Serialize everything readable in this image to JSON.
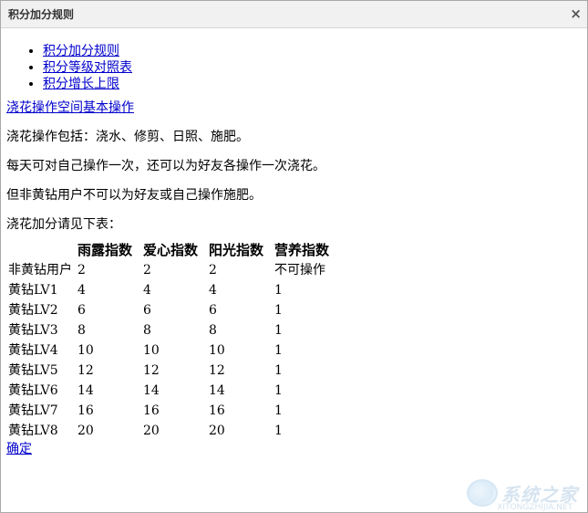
{
  "dialog": {
    "title": "积分加分规则",
    "close_glyph": "×"
  },
  "toc": [
    {
      "label": "积分加分规则"
    },
    {
      "label": "积分等级对照表"
    },
    {
      "label": "积分增长上限"
    }
  ],
  "section": {
    "heading_link": "浇花操作空间基本操作",
    "p1": "浇花操作包括：浇水、修剪、日照、施肥。",
    "p2": "每天可对自己操作一次，还可以为好友各操作一次浇花。",
    "p3": "但非黄钻用户不可以为好友或自己操作施肥。",
    "p4": "浇花加分请见下表："
  },
  "table": {
    "headers": [
      "",
      "雨露指数",
      "爱心指数",
      "阳光指数",
      "营养指数"
    ],
    "rows": [
      [
        "非黄钻用户",
        "2",
        "2",
        "2",
        "不可操作"
      ],
      [
        "黄钻LV1",
        "4",
        "4",
        "4",
        "1"
      ],
      [
        "黄钻LV2",
        "6",
        "6",
        "6",
        "1"
      ],
      [
        "黄钻LV3",
        "8",
        "8",
        "8",
        "1"
      ],
      [
        "黄钻LV4",
        "10",
        "10",
        "10",
        "1"
      ],
      [
        "黄钻LV5",
        "12",
        "12",
        "12",
        "1"
      ],
      [
        "黄钻LV6",
        "14",
        "14",
        "14",
        "1"
      ],
      [
        "黄钻LV7",
        "16",
        "16",
        "16",
        "1"
      ],
      [
        "黄钻LV8",
        "20",
        "20",
        "20",
        "1"
      ]
    ]
  },
  "confirm_label": "确定",
  "watermark": {
    "text": "系统之家",
    "url": "XITONGZHIJIA.NET",
    "color": "#cfe0ee"
  }
}
